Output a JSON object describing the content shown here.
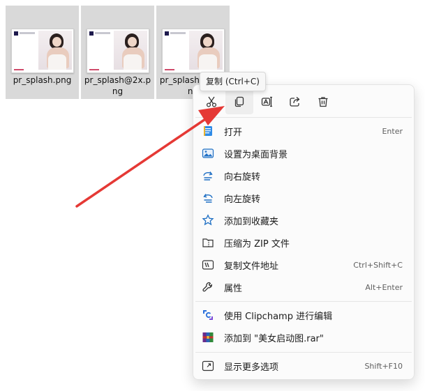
{
  "files": [
    {
      "name": "pr_splash.png"
    },
    {
      "name": "pr_splash@2x.png"
    },
    {
      "name": "pr_splash@2x.png"
    }
  ],
  "toolbar": {
    "tooltip": "复制 (Ctrl+C)",
    "buttons": [
      "scissors-icon",
      "copy-icon",
      "rename-icon",
      "share-icon",
      "trash-icon"
    ]
  },
  "menu": {
    "items": [
      {
        "label": "打开",
        "shortcut": "Enter",
        "icon": "open-notepad-icon"
      },
      {
        "label": "设置为桌面背景",
        "shortcut": "",
        "icon": "wallpaper-icon"
      },
      {
        "label": "向右旋转",
        "shortcut": "",
        "icon": "rotate-right-icon"
      },
      {
        "label": "向左旋转",
        "shortcut": "",
        "icon": "rotate-left-icon"
      },
      {
        "label": "添加到收藏夹",
        "shortcut": "",
        "icon": "star-icon"
      },
      {
        "label": "压缩为 ZIP 文件",
        "shortcut": "",
        "icon": "zip-icon"
      },
      {
        "label": "复制文件地址",
        "shortcut": "Ctrl+Shift+C",
        "icon": "copy-path-icon"
      },
      {
        "label": "属性",
        "shortcut": "Alt+Enter",
        "icon": "wrench-icon"
      },
      {
        "label": "使用 Clipchamp 进行编辑",
        "shortcut": "",
        "icon": "clipchamp-icon"
      },
      {
        "label": "添加到 \"美女启动图.rar\"",
        "shortcut": "",
        "icon": "winrar-icon"
      },
      {
        "label": "显示更多选项",
        "shortcut": "Shift+F10",
        "icon": "more-options-icon"
      }
    ]
  },
  "colors": {
    "accent": "#0067c0",
    "arrow": "#e53935",
    "selection": "#d9d9d9"
  }
}
